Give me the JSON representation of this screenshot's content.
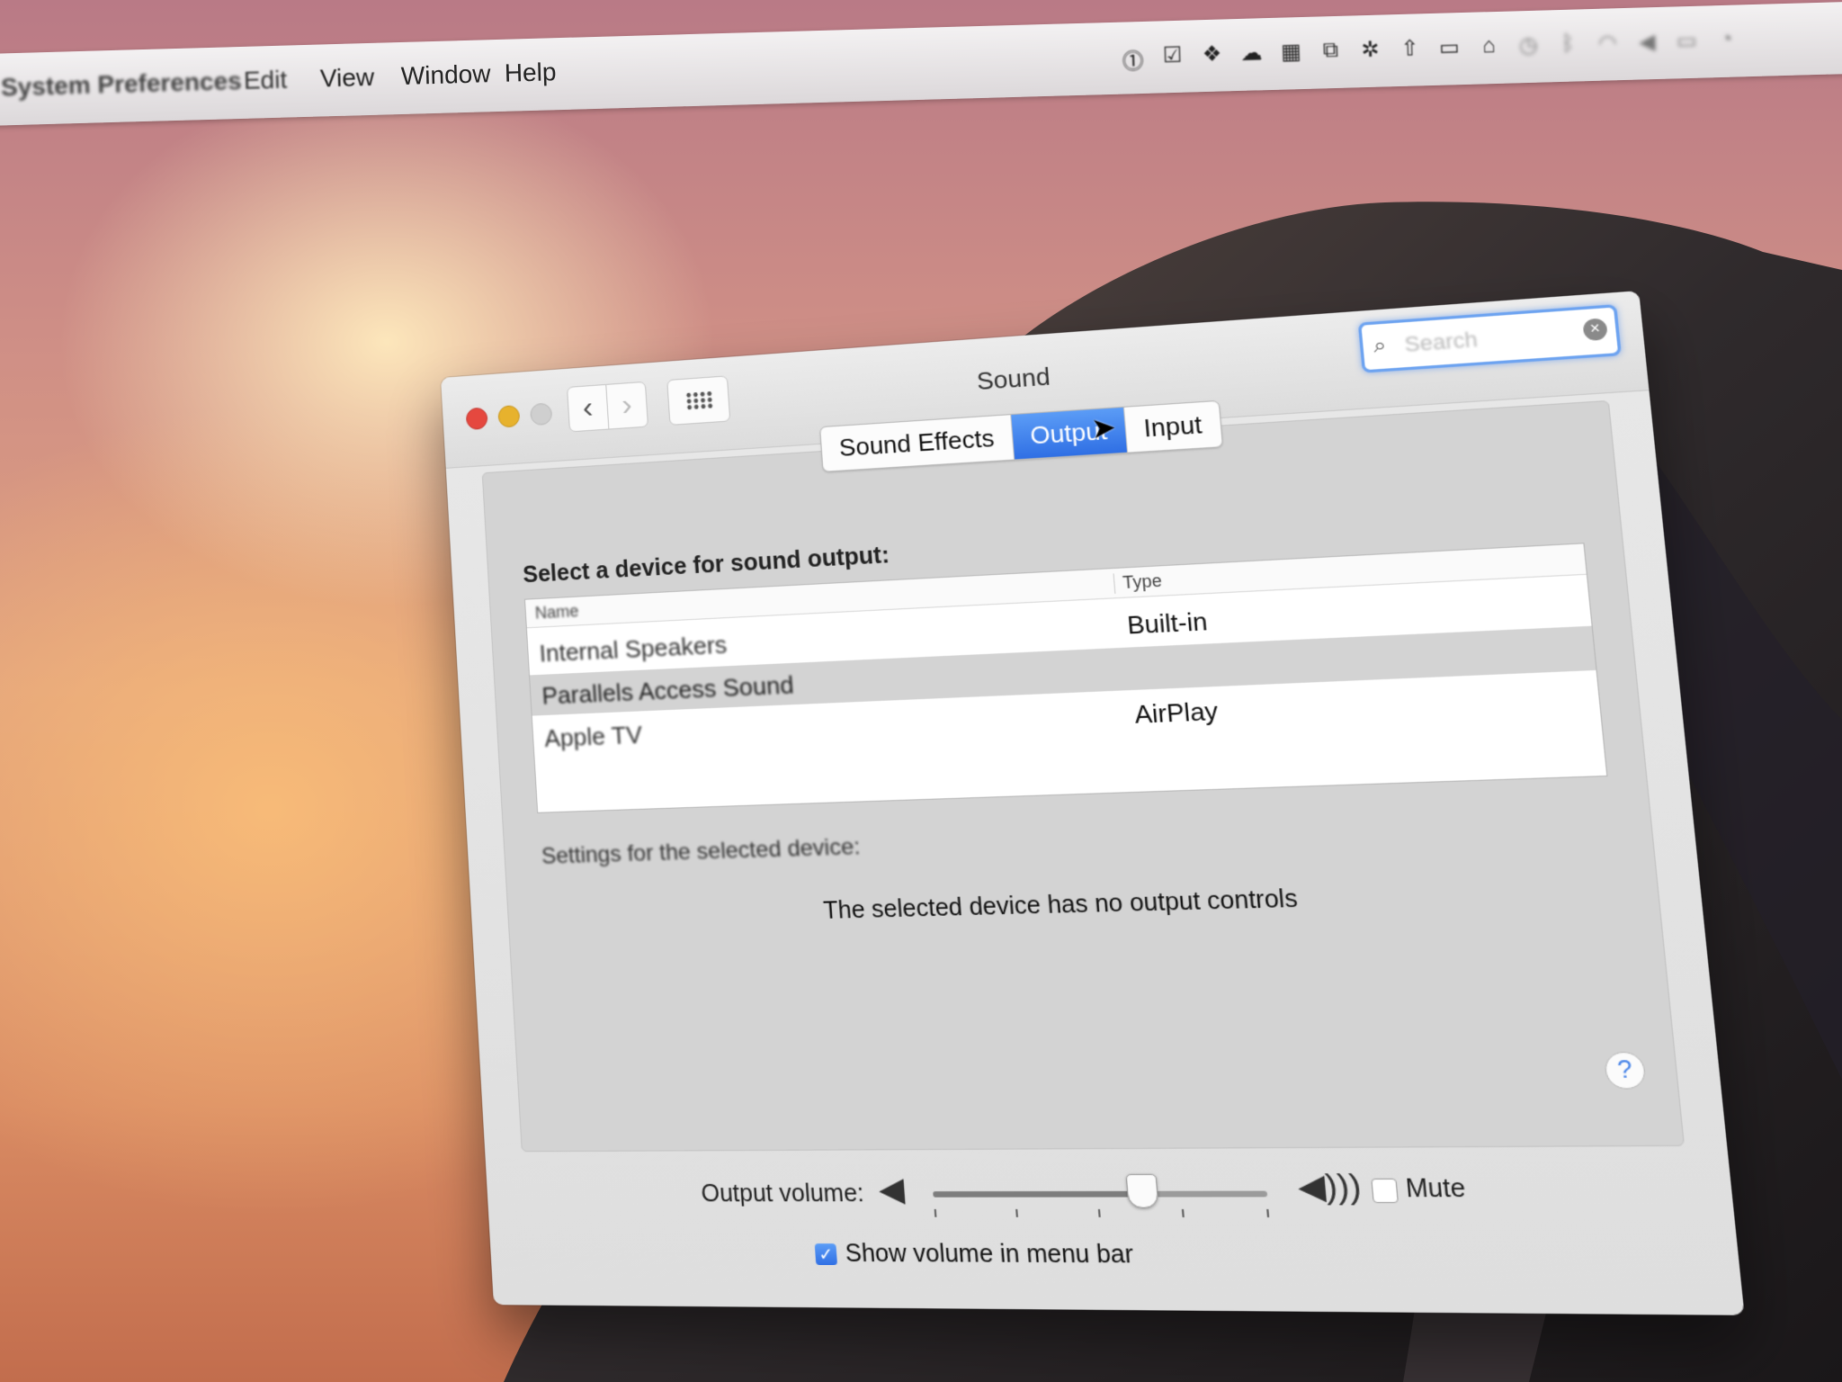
{
  "menubar": {
    "app_name": "System Preferences",
    "items": [
      "Edit",
      "View",
      "Window",
      "Help"
    ],
    "status_icons": [
      "password-manager-icon",
      "checklist-icon",
      "dropbox-icon",
      "cloud-icon",
      "calendar-icon",
      "clipboard-icon",
      "bug-icon",
      "upload-icon",
      "airplay-icon",
      "vpn-icon",
      "timemachine-icon",
      "bluetooth-icon",
      "wifi-icon",
      "volume-icon",
      "battery-icon",
      "clock-icon"
    ]
  },
  "window": {
    "title": "Sound",
    "search": {
      "placeholder": "Search"
    },
    "nav": {
      "back": "‹",
      "forward": "›"
    }
  },
  "tabs": [
    {
      "label": "Sound Effects",
      "active": false
    },
    {
      "label": "Output",
      "active": true
    },
    {
      "label": "Input",
      "active": false
    }
  ],
  "output": {
    "device_prompt": "Select a device for sound output:",
    "columns": {
      "name": "Name",
      "type": "Type"
    },
    "devices": [
      {
        "name": "Internal Speakers",
        "type": "Built-in",
        "selected": false
      },
      {
        "name": "Parallels Access Sound",
        "type": "",
        "selected": true
      },
      {
        "name": "Apple TV",
        "type": "AirPlay",
        "selected": false
      }
    ],
    "settings_label": "Settings for the selected device:",
    "no_controls": "The selected device has no output controls",
    "help": "?"
  },
  "volume": {
    "label": "Output volume:",
    "level": 0.63,
    "mute_label": "Mute",
    "mute_checked": false,
    "show_in_menu_label": "Show volume in menu bar",
    "show_in_menu_checked": true
  },
  "colors": {
    "accent": "#3478f6",
    "close": "#e5483f",
    "minimize": "#e7b22d"
  }
}
